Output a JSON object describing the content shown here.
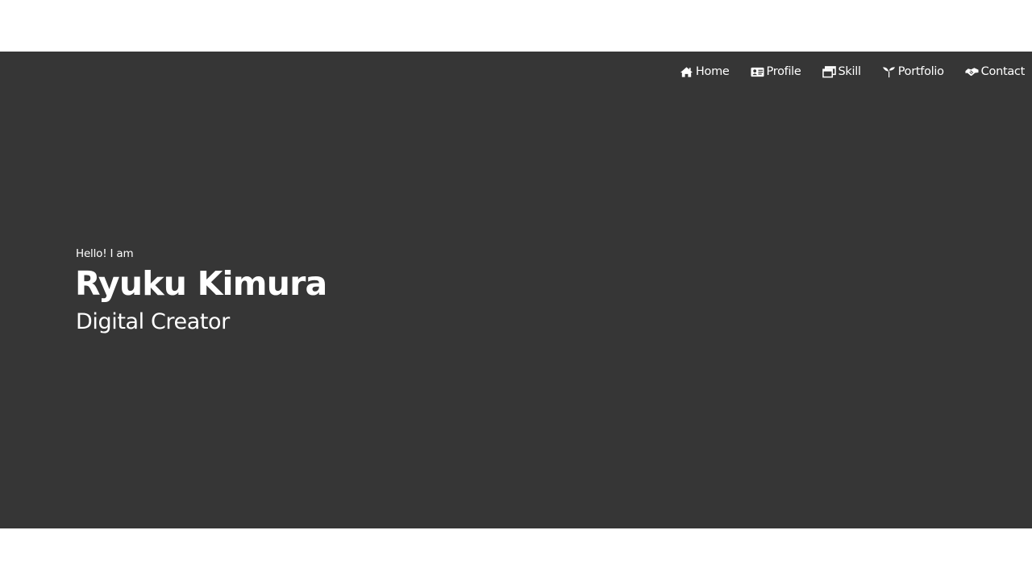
{
  "nav": {
    "items": [
      {
        "label": "Home",
        "icon": "home-icon"
      },
      {
        "label": "Profile",
        "icon": "id-card-icon"
      },
      {
        "label": "Skill",
        "icon": "window-icon"
      },
      {
        "label": "Portfolio",
        "icon": "seedling-icon"
      },
      {
        "label": "Contact",
        "icon": "handshake-icon"
      }
    ]
  },
  "hero": {
    "greeting": "Hello! I am",
    "name": "Ryuku Kimura",
    "role": "Digital Creator"
  },
  "colors": {
    "hero_background": "#363636",
    "page_background": "#ffffff",
    "text": "#ffffff"
  }
}
